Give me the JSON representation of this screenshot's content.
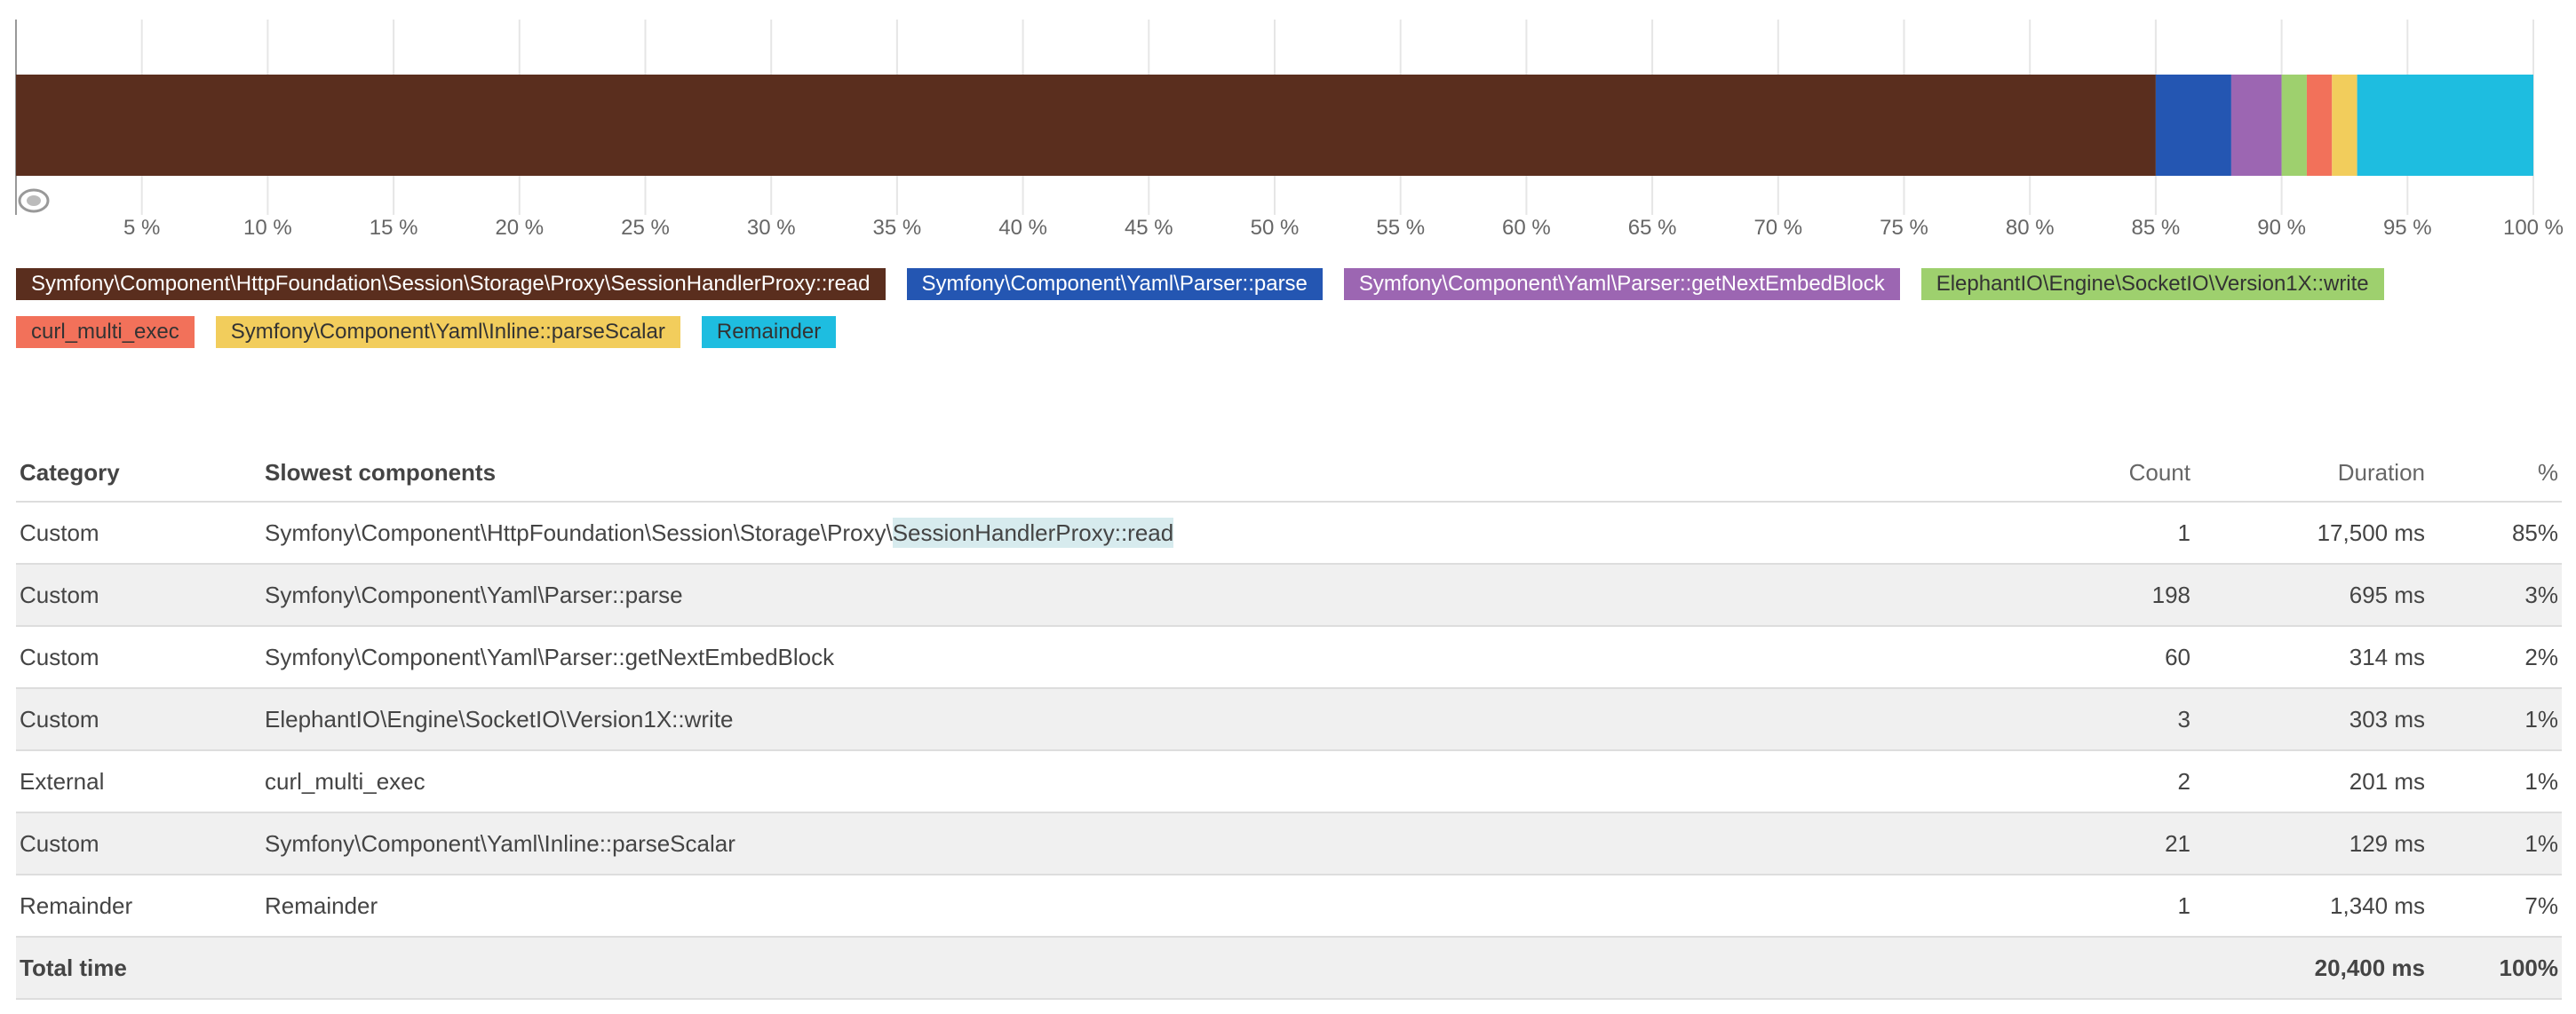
{
  "chart_data": {
    "type": "bar",
    "orientation": "horizontal-stacked",
    "xlim": [
      0,
      100
    ],
    "ticks": [
      "5 %",
      "10 %",
      "15 %",
      "20 %",
      "25 %",
      "30 %",
      "35 %",
      "40 %",
      "45 %",
      "50 %",
      "55 %",
      "60 %",
      "65 %",
      "70 %",
      "75 %",
      "80 %",
      "85 %",
      "90 %",
      "95 %",
      "100 %"
    ],
    "tick_values": [
      5,
      10,
      15,
      20,
      25,
      30,
      35,
      40,
      45,
      50,
      55,
      60,
      65,
      70,
      75,
      80,
      85,
      90,
      95,
      100
    ],
    "grid": true,
    "legend_position": "bottom",
    "series": [
      {
        "name": "Symfony\\Component\\HttpFoundation\\Session\\Storage\\Proxy\\SessionHandlerProxy::read",
        "value": 85,
        "color": "#5a2e1e"
      },
      {
        "name": "Symfony\\Component\\Yaml\\Parser::parse",
        "value": 3,
        "color": "#2456b2"
      },
      {
        "name": "Symfony\\Component\\Yaml\\Parser::getNextEmbedBlock",
        "value": 2,
        "color": "#9c66b2"
      },
      {
        "name": "ElephantIO\\Engine\\SocketIO\\Version1X::write",
        "value": 1,
        "color": "#9ed06e"
      },
      {
        "name": "curl_multi_exec",
        "value": 1,
        "color": "#f2715a"
      },
      {
        "name": "Symfony\\Component\\Yaml\\Inline::parseScalar",
        "value": 1,
        "color": "#f2cd5c"
      },
      {
        "name": "Remainder",
        "value": 7,
        "color": "#1ebde0"
      }
    ]
  },
  "table": {
    "headers": {
      "category": "Category",
      "component": "Slowest components",
      "count": "Count",
      "duration": "Duration",
      "percent": "%"
    },
    "rows": [
      {
        "category": "Custom",
        "component_prefix": "Symfony\\Component\\HttpFoundation\\Session\\Storage\\Proxy\\",
        "component_highlight": "SessionHandlerProxy::read",
        "count": "1",
        "duration": "17,500 ms",
        "percent": "85%"
      },
      {
        "category": "Custom",
        "component_prefix": "Symfony\\Component\\Yaml\\Parser::parse",
        "component_highlight": "",
        "count": "198",
        "duration": "695 ms",
        "percent": "3%"
      },
      {
        "category": "Custom",
        "component_prefix": "Symfony\\Component\\Yaml\\Parser::getNextEmbedBlock",
        "component_highlight": "",
        "count": "60",
        "duration": "314 ms",
        "percent": "2%"
      },
      {
        "category": "Custom",
        "component_prefix": "ElephantIO\\Engine\\SocketIO\\Version1X::write",
        "component_highlight": "",
        "count": "3",
        "duration": "303 ms",
        "percent": "1%"
      },
      {
        "category": "External",
        "component_prefix": "curl_multi_exec",
        "component_highlight": "",
        "count": "2",
        "duration": "201 ms",
        "percent": "1%"
      },
      {
        "category": "Custom",
        "component_prefix": "Symfony\\Component\\Yaml\\Inline::parseScalar",
        "component_highlight": "",
        "count": "21",
        "duration": "129 ms",
        "percent": "1%"
      },
      {
        "category": "Remainder",
        "component_prefix": "Remainder",
        "component_highlight": "",
        "count": "1",
        "duration": "1,340 ms",
        "percent": "7%"
      }
    ],
    "total": {
      "label": "Total time",
      "duration": "20,400 ms",
      "percent": "100%"
    }
  }
}
